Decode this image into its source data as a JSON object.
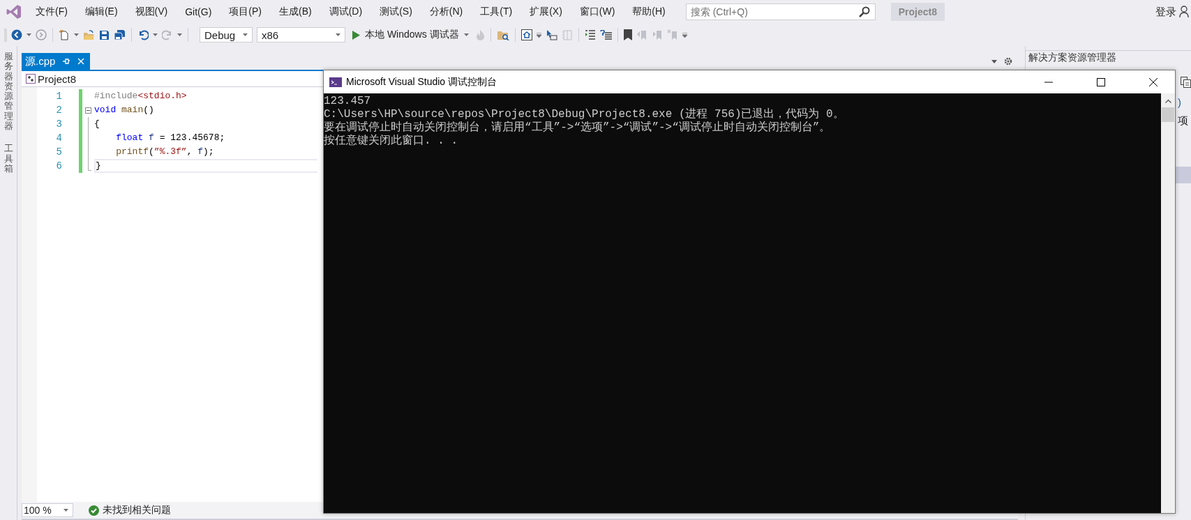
{
  "menu": [
    "文件(F)",
    "编辑(E)",
    "视图(V)",
    "Git(G)",
    "项目(P)",
    "生成(B)",
    "调试(D)",
    "测试(S)",
    "分析(N)",
    "工具(T)",
    "扩展(X)",
    "窗口(W)",
    "帮助(H)"
  ],
  "search": {
    "placeholder": "搜索 (Ctrl+Q)"
  },
  "project_badge": "Project8",
  "sign_in": "登录",
  "toolbar": {
    "configuration": "Debug",
    "platform": "x86",
    "debugger": "本地 Windows 调试器"
  },
  "side_tabs": [
    "服务器资源管理器",
    "工具箱"
  ],
  "editor": {
    "tabs": [
      {
        "label": "源.cpp",
        "selected": true
      }
    ],
    "scope": "Project8",
    "lines": [
      {
        "number": "1",
        "tokens": [
          {
            "kind": "preproc",
            "text": "#include"
          },
          {
            "kind": "string",
            "text": "<stdio.h>"
          }
        ]
      },
      {
        "number": "2",
        "expanded": true,
        "tokens": [
          {
            "kind": "keyword",
            "text": "void"
          },
          {
            "kind": "function",
            "text": " main"
          },
          {
            "kind": "plain",
            "text": "()"
          }
        ]
      },
      {
        "number": "3",
        "tokens": [
          {
            "kind": "plain",
            "text": "{"
          }
        ]
      },
      {
        "number": "4",
        "tokens": [
          {
            "kind": "keyword",
            "text": "    float"
          },
          {
            "kind": "variable",
            "text": " f"
          },
          {
            "kind": "plain",
            "text": " = 123.45678;"
          }
        ]
      },
      {
        "number": "5",
        "tokens": [
          {
            "kind": "function",
            "text": "    printf"
          },
          {
            "kind": "plain",
            "text": "("
          },
          {
            "kind": "string",
            "text": "”%.3f”"
          },
          {
            "kind": "plain",
            "text": ", "
          },
          {
            "kind": "variable",
            "text": "f"
          },
          {
            "kind": "plain",
            "text": ");"
          }
        ]
      },
      {
        "number": "6",
        "tokens": [
          {
            "kind": "plain",
            "text": "}"
          }
        ]
      }
    ],
    "zoom": "100 %",
    "status": "未找到相关问题"
  },
  "solution_explorer": {
    "title": "解决方案资源管理器",
    "row_1": ")",
    "row_2": "项"
  },
  "console": {
    "title": "Microsoft Visual Studio 调试控制台",
    "lines": [
      "123.457",
      "C:\\Users\\HP\\source\\repos\\Project8\\Debug\\Project8.exe (进程 756)已退出，代码为 0。",
      "要在调试停止时自动关闭控制台，请启用“工具”->“选项”->“调试”->“调试停止时自动关闭控制台”。",
      "按任意键关闭此窗口. . ."
    ]
  }
}
